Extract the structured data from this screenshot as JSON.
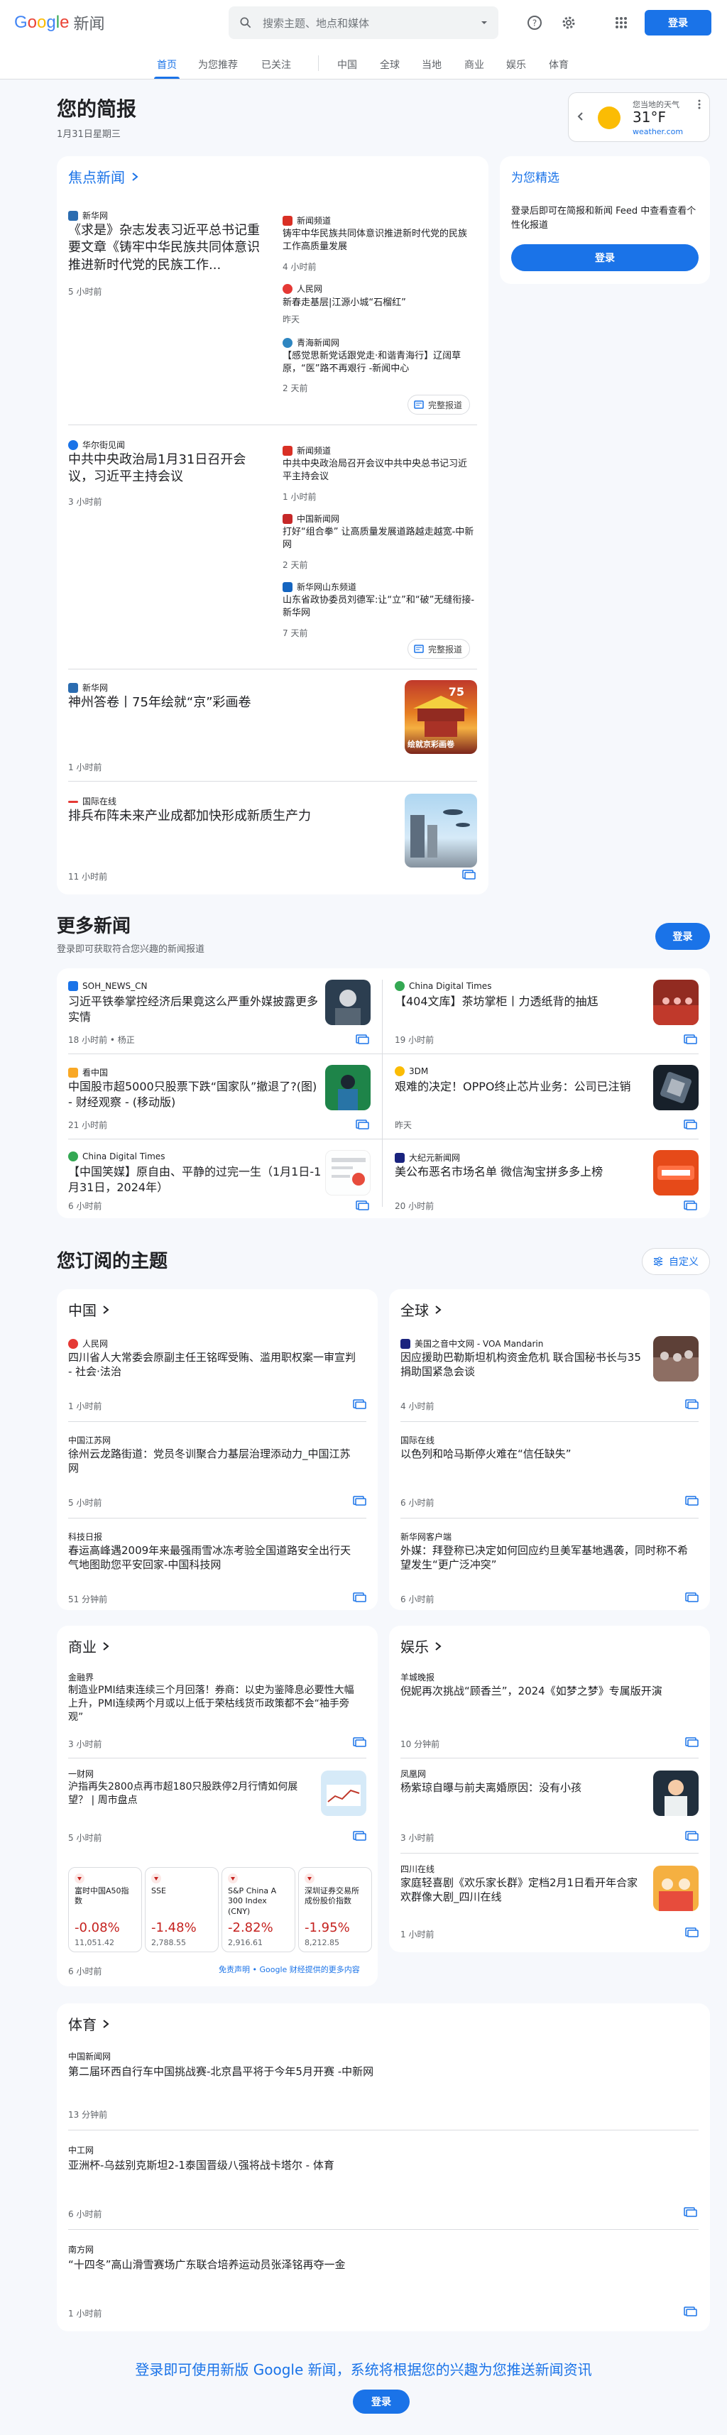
{
  "header": {
    "logo_google": "Google",
    "logo_news": "新闻",
    "search_placeholder": "搜索主题、地点和媒体",
    "signin_label": "登录"
  },
  "nav": {
    "tabs": [
      "首页",
      "为您推荐",
      "已关注",
      "中国",
      "全球",
      "当地",
      "商业",
      "娱乐",
      "体育"
    ],
    "active": "首页"
  },
  "briefing": {
    "title": "您的简报",
    "date": "1月31日星期三"
  },
  "weather": {
    "label": "您当地的天气",
    "temp": "31°F",
    "source": "weather.com"
  },
  "top_stories": {
    "link": "焦点新闻",
    "clusters": [
      {
        "main": {
          "source": "新华网",
          "title": "《求是》杂志发表习近平总书记重要文章《铸牢中华民族共同体意识推进新时代党的民族工作...",
          "time": "5 小时前"
        },
        "side": [
          {
            "source": "新闻频道",
            "title": "铸牢中华民族共同体意识推进新时代党的民族工作高质量发展",
            "time": "4 小时前"
          },
          {
            "source": "人民网",
            "title": "新春走基层|江源小城“石榴红”",
            "time": "昨天"
          },
          {
            "source": "青海新闻网",
            "title": "【感觉思新党话跟党走·和谐青海行】辽阔草原，“医”路不再艰行 -新闻中心",
            "time": "2 天前"
          }
        ],
        "full_coverage": "完整报道"
      },
      {
        "main": {
          "source": "华尔街见闻",
          "title": "中共中央政治局1月31日召开会议，习近平主持会议",
          "time": "3 小时前"
        },
        "side": [
          {
            "source": "新闻频道",
            "title": "中共中央政治局召开会议中共中央总书记习近平主持会议",
            "time": "1 小时前"
          },
          {
            "source": "中国新闻网",
            "title": "打好“组合拳” 让高质量发展道路越走越宽-中新网",
            "time": "2 天前"
          },
          {
            "source": "新华网山东频道",
            "title": "山东省政协委员刘德军:让“立”和“破”无缝衔接-新华网",
            "time": "7 天前"
          }
        ],
        "full_coverage": "完整报道"
      },
      {
        "main": {
          "source": "新华网",
          "title": "神州答卷丨75年绘就“京”彩画卷",
          "time": "1 小时前"
        },
        "thumb_text": "绘就京彩画卷"
      },
      {
        "main": {
          "source": "国际在线",
          "title": "排兵布阵未来产业成都加快形成新质生产力",
          "time": "11 小时前"
        }
      }
    ]
  },
  "picks": {
    "title": "为您精选",
    "desc": "登录后即可在简报和新闻 Feed 中查看查看个性化报道",
    "button": "登录"
  },
  "more_news": {
    "title": "更多新闻",
    "subtitle": "登录即可获取符合您兴趣的新闻报道",
    "button": "登录",
    "items": [
      {
        "source": "SOH_NEWS_CN",
        "title": "习近平铁拳掌控经济后果竟这么严重外媒披露更多实情",
        "time": "18 小时前 • 杨正"
      },
      {
        "source": "China Digital Times",
        "title": "【404文库】茶坊掌柜丨力透纸背的抽尪",
        "time": "19 小时前"
      },
      {
        "source": "看中国",
        "title": "中国股市超5000只股票下跌“国家队”撤退了?(图) - 财经观察 - (移动版)",
        "time": "21 小时前"
      },
      {
        "source": "3DM",
        "title": "艰难的决定！OPPO终止芯片业务：公司已注销",
        "time": "昨天"
      },
      {
        "source": "China Digital Times",
        "title": "【中国笑媒】原自由、平静的过完一生（1月1日-1月31日，2024年）",
        "time": "6 小时前"
      },
      {
        "source": "大纪元新闻网",
        "title": "美公布恶名市场名单 微信淘宝拼多多上榜",
        "time": "20 小时前"
      }
    ]
  },
  "topics": {
    "title": "您订阅的主题",
    "customize": "自定义",
    "china": {
      "name": "中国",
      "items": [
        {
          "source": "人民网",
          "title": "四川省人大常委会原副主任王铭晖受贿、滥用职权案一审宣判 - 社会·法治",
          "time": "1 小时前"
        },
        {
          "source": "中国江苏网",
          "title": "徐州云龙路街道：党员冬训聚合力基层治理添动力_中国江苏网",
          "time": "5 小时前"
        },
        {
          "source": "科技日报",
          "title": "春运高峰遇2009年来最强雨雪冰冻考验全国道路安全出行天气地图助您平安回家-中国科技网",
          "time": "51 分钟前"
        }
      ]
    },
    "world": {
      "name": "全球",
      "items": [
        {
          "source": "美国之音中文网 - VOA Mandarin",
          "title": "因应援助巴勒斯坦机构资金危机 联合国秘书长与35捐助国紧急会谈",
          "time": "4 小时前"
        },
        {
          "source": "国际在线",
          "title": "以色列和哈马斯停火难在“信任缺失”",
          "time": "6 小时前"
        },
        {
          "source": "新华网客户端",
          "title": "外媒：拜登称已决定如何回应约旦美军基地遇袭，同时称不希望发生“更广泛冲突”",
          "time": "6 小时前"
        }
      ]
    },
    "business": {
      "name": "商业",
      "items": [
        {
          "source": "金融界",
          "title": "制造业PMI结束连续三个月回落！券商：以史为鉴降息必要性大幅上升，PMI连续两个月或以上低于荣枯线货币政策都不会“袖手旁观”",
          "time": "3 小时前"
        },
        {
          "source": "一财网",
          "title": "沪指再失2800点再市超180只股跌停2月行情如何展望？ | 周市盘点",
          "time": "5 小时前"
        }
      ],
      "markets": [
        {
          "name": "富时中国A50指数",
          "change": "-0.08%",
          "value": "11,051.42",
          "down": true
        },
        {
          "name": "SSE",
          "change": "-1.48%",
          "value": "2,788.55",
          "down": true
        },
        {
          "name": "S&P China A 300 Index (CNY)",
          "change": "-2.82%",
          "value": "2,916.61",
          "down": true
        },
        {
          "name": "深圳证券交易所成份股价指数",
          "change": "-1.95%",
          "value": "8,212.85",
          "down": true
        }
      ],
      "markets_time": "6 小时前",
      "disclaimer": "免责声明 • Google 财经提供的更多内容"
    },
    "entertainment": {
      "name": "娱乐",
      "items": [
        {
          "source": "羊城晚报",
          "title": "倪妮再次挑战“顾香兰”，2024《如梦之梦》专属版开演",
          "time": "10 分钟前"
        },
        {
          "source": "凤凰网",
          "title": "杨紫琼自曝与前夫离婚原因：没有小孩",
          "time": "3 小时前"
        },
        {
          "source": "四川在线",
          "title": "家庭轻喜剧《欢乐家长群》定档2月1日看开年合家欢群像大剧_四川在线",
          "time": "1 小时前"
        }
      ]
    },
    "sports": {
      "name": "体育",
      "items": [
        {
          "source": "中国新闻网",
          "title": "第二届环西自行车中国挑战赛-北京昌平将于今年5月开赛 -中新网",
          "time": "13 分钟前"
        },
        {
          "source": "中工网",
          "title": "亚洲杯-乌兹别克斯坦2-1泰国晋级八强将战卡塔尔 - 体育",
          "time": "6 小时前"
        },
        {
          "source": "南方网",
          "title": "“十四冬”高山滑雪赛场广东联合培养运动员张泽铭再夺一金",
          "time": "1 小时前"
        }
      ]
    }
  },
  "footer": {
    "text": "登录即可使用新版 Google 新闻，系统将根据您的兴趣为您推送新闻资讯",
    "button": "登录"
  },
  "colors": {
    "accent": "#1a73e8",
    "up": "#137333",
    "down": "#c5221f"
  }
}
